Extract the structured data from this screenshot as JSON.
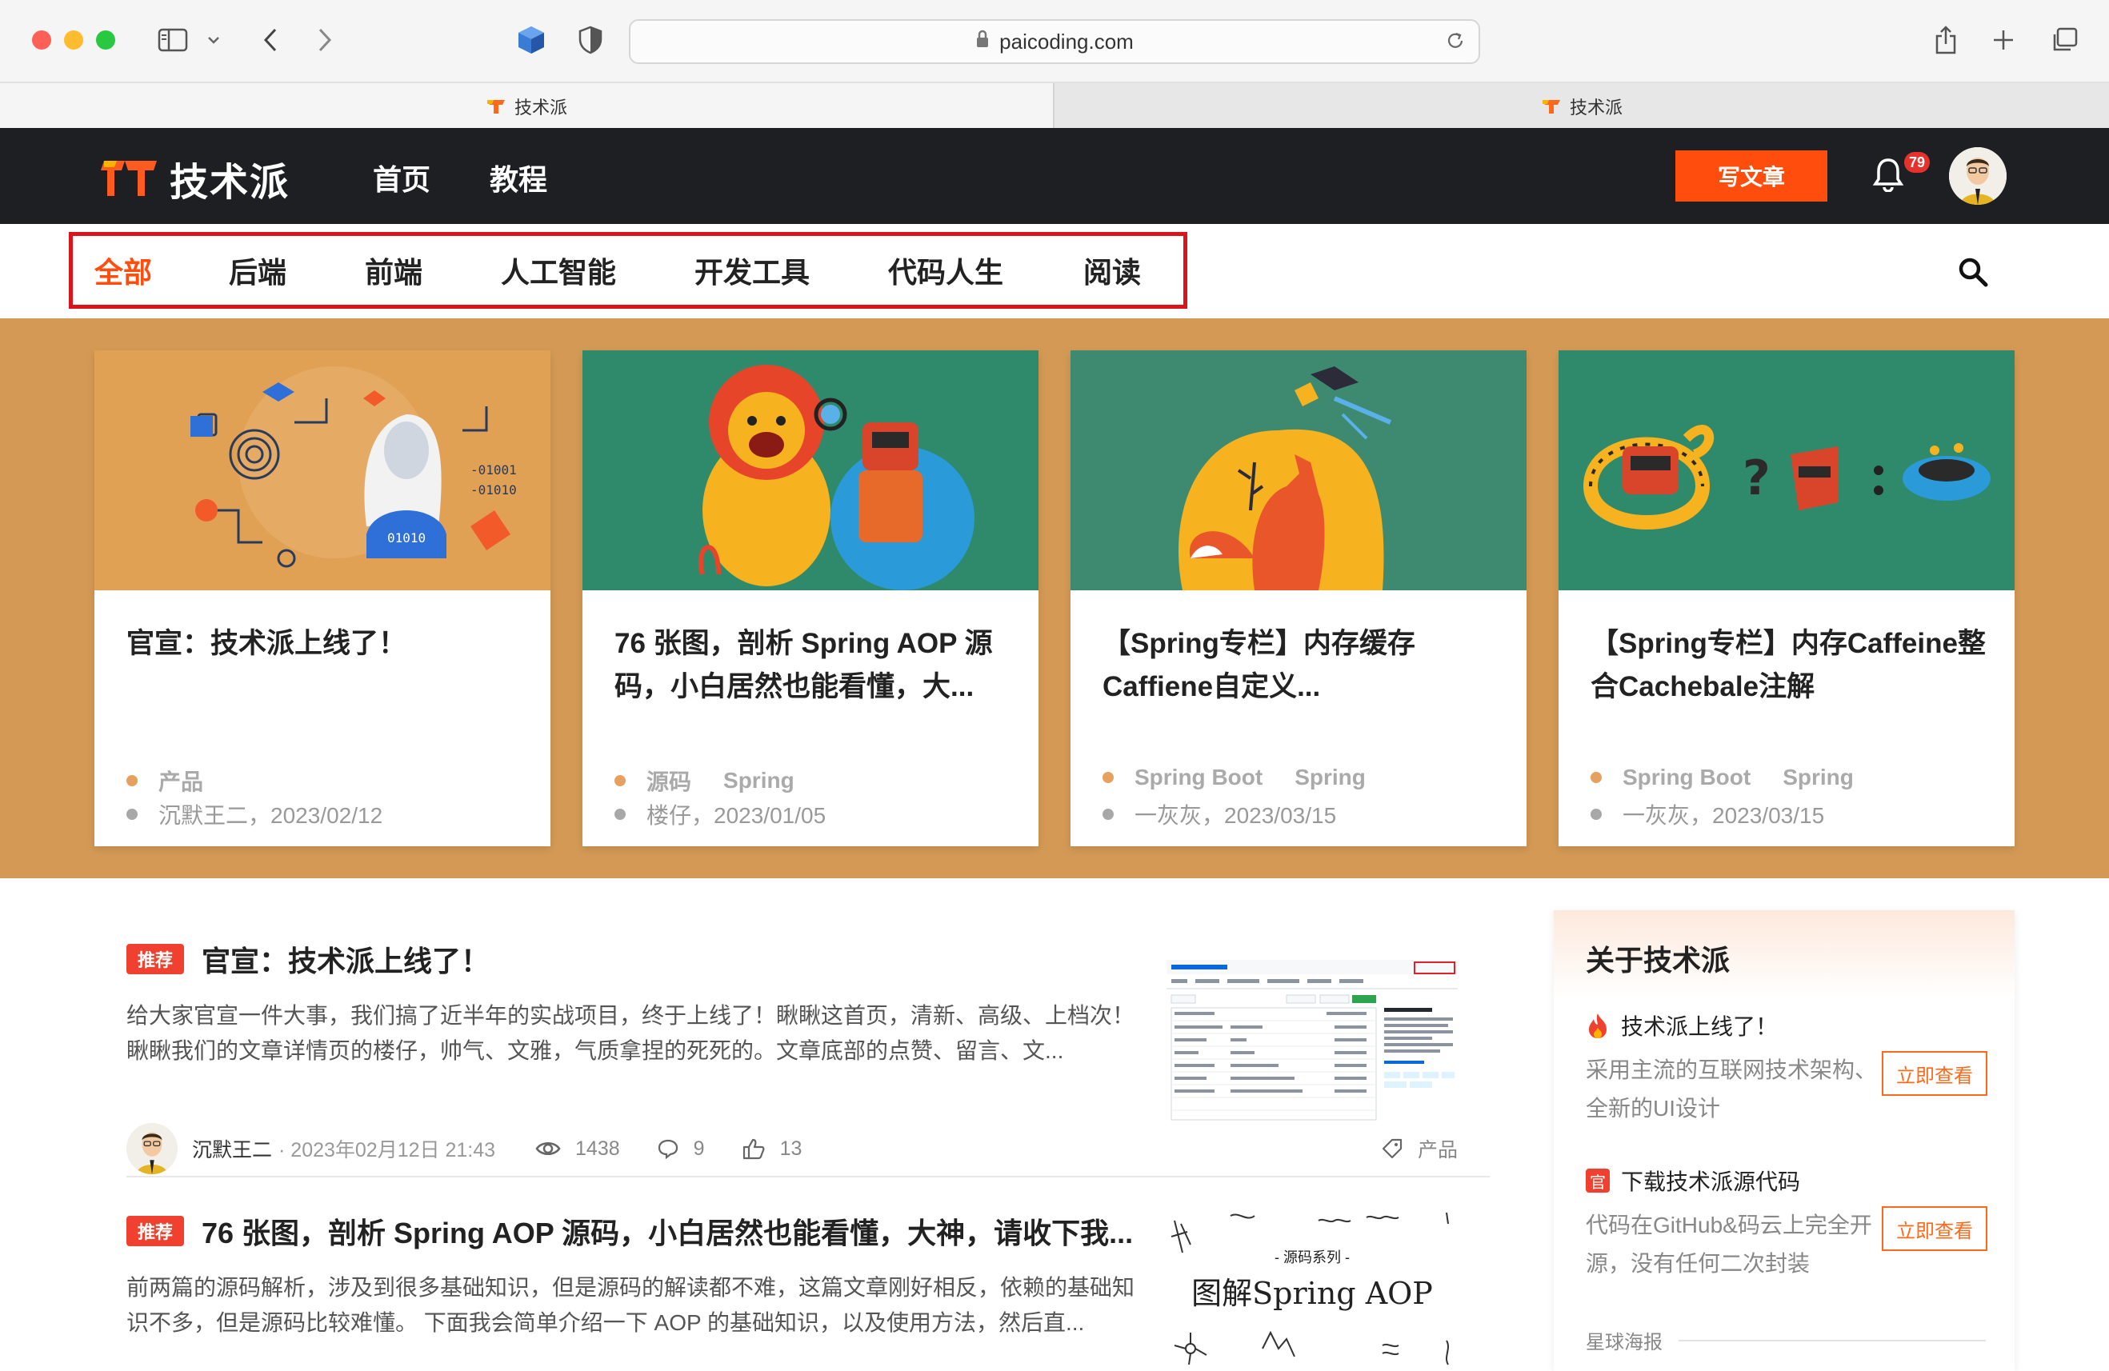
{
  "browser": {
    "url": "paicoding.com",
    "tabs": [
      {
        "title": "技术派",
        "active": true
      },
      {
        "title": "技术派",
        "active": false
      }
    ]
  },
  "header": {
    "logo_text": "技术派",
    "nav": [
      "首页",
      "教程"
    ],
    "write_button": "写文章",
    "notification_count": "79"
  },
  "categories": {
    "items": [
      "全部",
      "后端",
      "前端",
      "人工智能",
      "开发工具",
      "代码人生",
      "阅读"
    ],
    "active_index": 0
  },
  "banner_cards": [
    {
      "title": "官宣：技术派上线了！",
      "tags": [
        "产品"
      ],
      "author_date": "沉默王二，2023/02/12"
    },
    {
      "title": "76 张图，剖析 Spring AOP 源码，小白居然也能看懂，大...",
      "tags": [
        "源码",
        "Spring"
      ],
      "author_date": "楼仔，2023/01/05"
    },
    {
      "title": "【Spring专栏】内存缓存Caffiene自定义...",
      "tags": [
        "Spring Boot",
        "Spring"
      ],
      "author_date": "一灰灰，2023/03/15"
    },
    {
      "title": "【Spring专栏】内存Caffeine整合Cachebale注解",
      "tags": [
        "Spring Boot",
        "Spring"
      ],
      "author_date": "一灰灰，2023/03/15"
    }
  ],
  "feed": [
    {
      "badge": "推荐",
      "title": "官宣：技术派上线了！",
      "summary": "给大家官宣一件大事，我们搞了近半年的实战项目，终于上线了！瞅瞅这首页，清新、高级、上档次！瞅瞅我们的文章详情页的楼仔，帅气、文雅，气质拿捏的死死的。文章底部的点赞、留言、文...",
      "author": "沉默王二",
      "date": "· 2023年02月12日 21:43",
      "views": "1438",
      "comments": "9",
      "likes": "13",
      "category": "产品"
    },
    {
      "badge": "推荐",
      "title": "76 张图，剖析 Spring AOP 源码，小白居然也能看懂，大神，请收下我...",
      "summary": "前两篇的源码解析，涉及到很多基础知识，但是源码的解读都不难，这篇文章刚好相反，依赖的基础知识不多，但是源码比较难懂。 下面我会简单介绍一下 AOP 的基础知识，以及使用方法，然后直...",
      "thumb_caption_small": "- 源码系列 -",
      "thumb_caption": "图解Spring AOP"
    }
  ],
  "sidebar": {
    "title": "关于技术派",
    "items": [
      {
        "title": "技术派上线了！",
        "desc": "采用主流的互联网技术架构、全新的UI设计",
        "button": "立即查看",
        "icon_color": "#f0402f"
      },
      {
        "title": "下载技术派源代码",
        "desc": "代码在GitHub&码云上完全开源，没有任何二次封装",
        "button": "立即查看",
        "icon_color": "#f0402f",
        "icon_char": "官"
      }
    ],
    "footer_label": "星球海报"
  },
  "colors": {
    "accent": "#ff4d0d",
    "header_bg": "#1d1f22",
    "banner_bg": "#d49a55",
    "highlight_box": "#d9151b"
  }
}
